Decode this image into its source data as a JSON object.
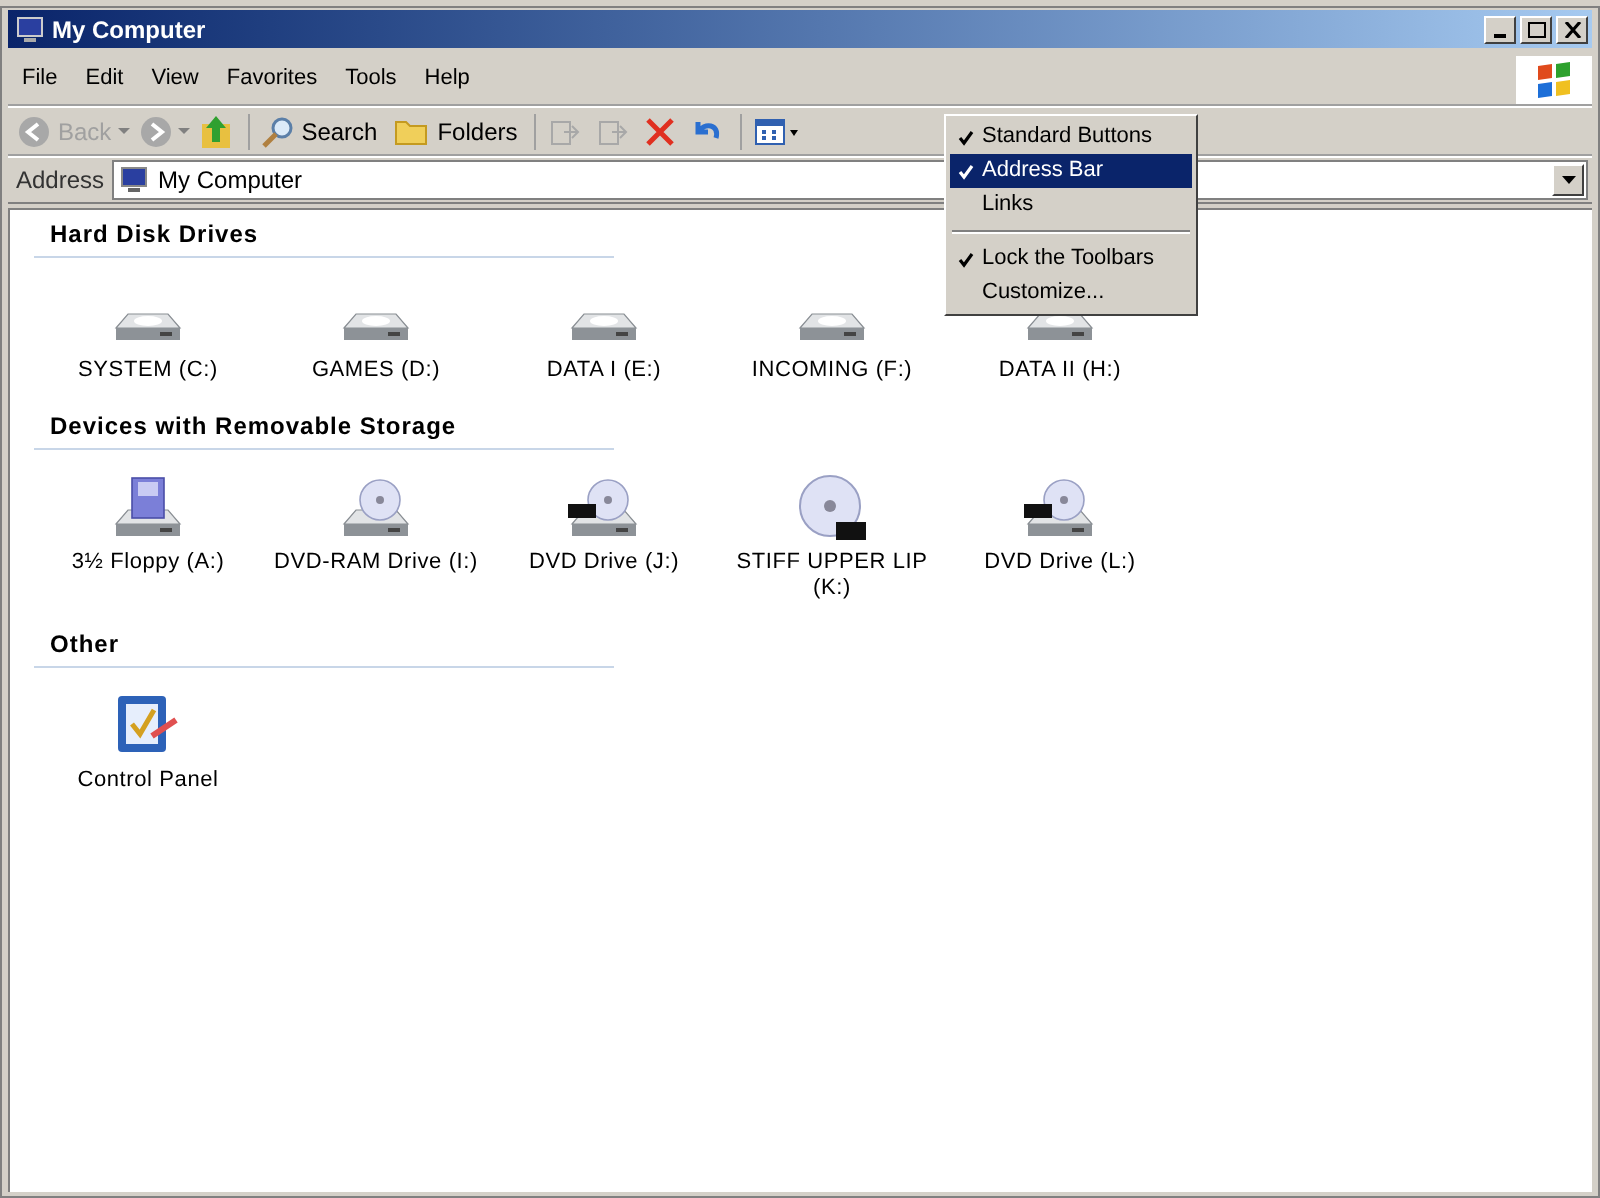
{
  "window": {
    "title": "My Computer"
  },
  "menu_bar": [
    "File",
    "Edit",
    "View",
    "Favorites",
    "Tools",
    "Help"
  ],
  "toolbar": [
    {
      "kind": "back",
      "label": "Back",
      "disabled": true
    },
    {
      "kind": "forward",
      "disabled": true
    },
    {
      "kind": "up",
      "disabled": false
    },
    {
      "kind": "search",
      "label": "Search",
      "disabled": false
    },
    {
      "kind": "folders",
      "label": "Folders",
      "disabled": false
    },
    {
      "kind": "moveto",
      "disabled": true
    },
    {
      "kind": "copyto",
      "disabled": true
    },
    {
      "kind": "delete",
      "disabled": false
    },
    {
      "kind": "undo",
      "disabled": false
    },
    {
      "kind": "views",
      "disabled": false
    }
  ],
  "address_bar": {
    "label": "Address",
    "value": "My Computer"
  },
  "sections": [
    {
      "title": "Hard Disk Drives",
      "items": [
        {
          "kind": "hdd",
          "label": "SYSTEM (C:)"
        },
        {
          "kind": "hdd",
          "label": "GAMES (D:)"
        },
        {
          "kind": "hdd",
          "label": "DATA I (E:)"
        },
        {
          "kind": "hdd",
          "label": "INCOMING (F:)"
        },
        {
          "kind": "hdd",
          "label": "DATA II (H:)"
        }
      ]
    },
    {
      "title": "Devices with Removable Storage",
      "items": [
        {
          "kind": "floppy",
          "label": "3½ Floppy (A:)"
        },
        {
          "kind": "dvdram",
          "label": "DVD-RAM Drive (I:)"
        },
        {
          "kind": "dvd",
          "label": "DVD Drive (J:)"
        },
        {
          "kind": "disc",
          "label": "STIFF UPPER LIP (K:)"
        },
        {
          "kind": "dvd",
          "label": "DVD Drive (L:)"
        }
      ]
    },
    {
      "title": "Other",
      "items": [
        {
          "kind": "controlpanel",
          "label": "Control Panel"
        }
      ]
    }
  ],
  "context_menu": [
    {
      "kind": "item",
      "label": "Standard Buttons",
      "checked": true,
      "selected": false
    },
    {
      "kind": "item",
      "label": "Address Bar",
      "checked": true,
      "selected": true
    },
    {
      "kind": "item",
      "label": "Links",
      "checked": false,
      "selected": false
    },
    {
      "kind": "separator"
    },
    {
      "kind": "item",
      "label": "Lock the Toolbars",
      "checked": true,
      "selected": false
    },
    {
      "kind": "item",
      "label": "Customize...",
      "checked": false,
      "selected": false
    }
  ]
}
